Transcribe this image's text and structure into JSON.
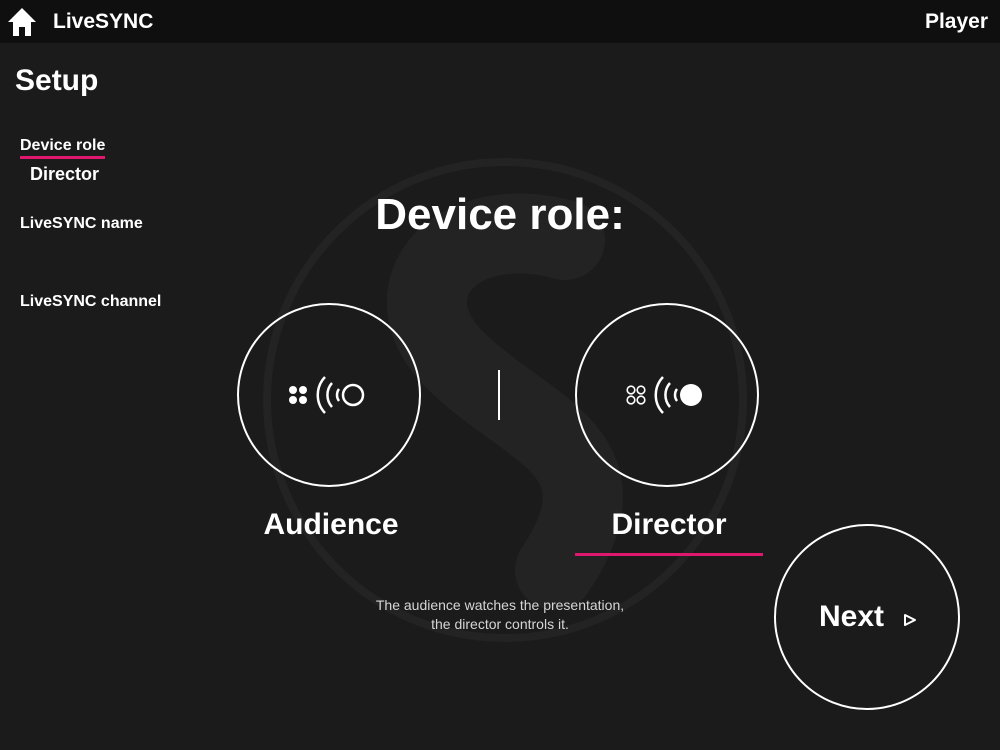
{
  "header": {
    "home_icon": "home-icon",
    "app_name": "LiveSYNC",
    "player_label": "Player"
  },
  "sidebar": {
    "title": "Setup",
    "items": [
      {
        "label": "Device role",
        "value": "Director",
        "active": true
      },
      {
        "label": "LiveSYNC name",
        "value": "",
        "active": false
      },
      {
        "label": "LiveSYNC channel",
        "value": "",
        "active": false
      }
    ]
  },
  "main": {
    "heading": "Device role:",
    "options": [
      {
        "label": "Audience",
        "icon": "audience-broadcast-icon",
        "selected": false
      },
      {
        "label": "Director",
        "icon": "director-broadcast-icon",
        "selected": true
      }
    ],
    "description": [
      "The audience watches the presentation,",
      "the director controls it."
    ],
    "next_label": "Next",
    "next_icon": "play-arrow-icon"
  },
  "colors": {
    "background": "#1b1b1b",
    "topbar": "#0f0f0f",
    "accent": "#e0176f",
    "text": "#ffffff"
  }
}
